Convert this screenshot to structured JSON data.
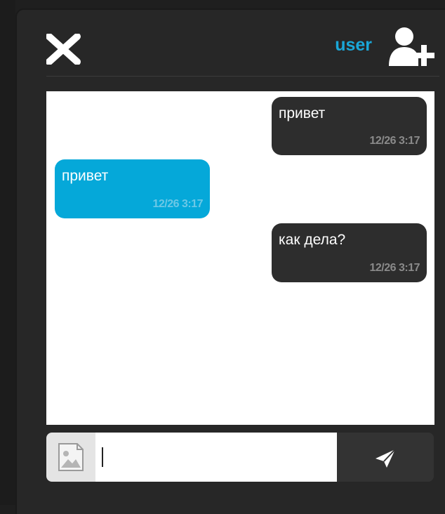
{
  "header": {
    "username": "user",
    "close_icon": "close-icon",
    "add_user_icon": "add-user-icon",
    "accent_color": "#1aa7d8"
  },
  "messages": [
    {
      "direction": "out",
      "text": "привет",
      "time": "12/26 3:17"
    },
    {
      "direction": "in",
      "text": "привет",
      "time": "12/26 3:17"
    },
    {
      "direction": "out",
      "text": "как дела?",
      "time": "12/26 3:17"
    }
  ],
  "composer": {
    "value": "",
    "placeholder": "",
    "attach_icon": "image-icon",
    "send_icon": "send-icon"
  },
  "colors": {
    "outgoing_bubble": "#2d2d2d",
    "incoming_bubble": "#05a8d9",
    "panel_background": "#272727"
  }
}
